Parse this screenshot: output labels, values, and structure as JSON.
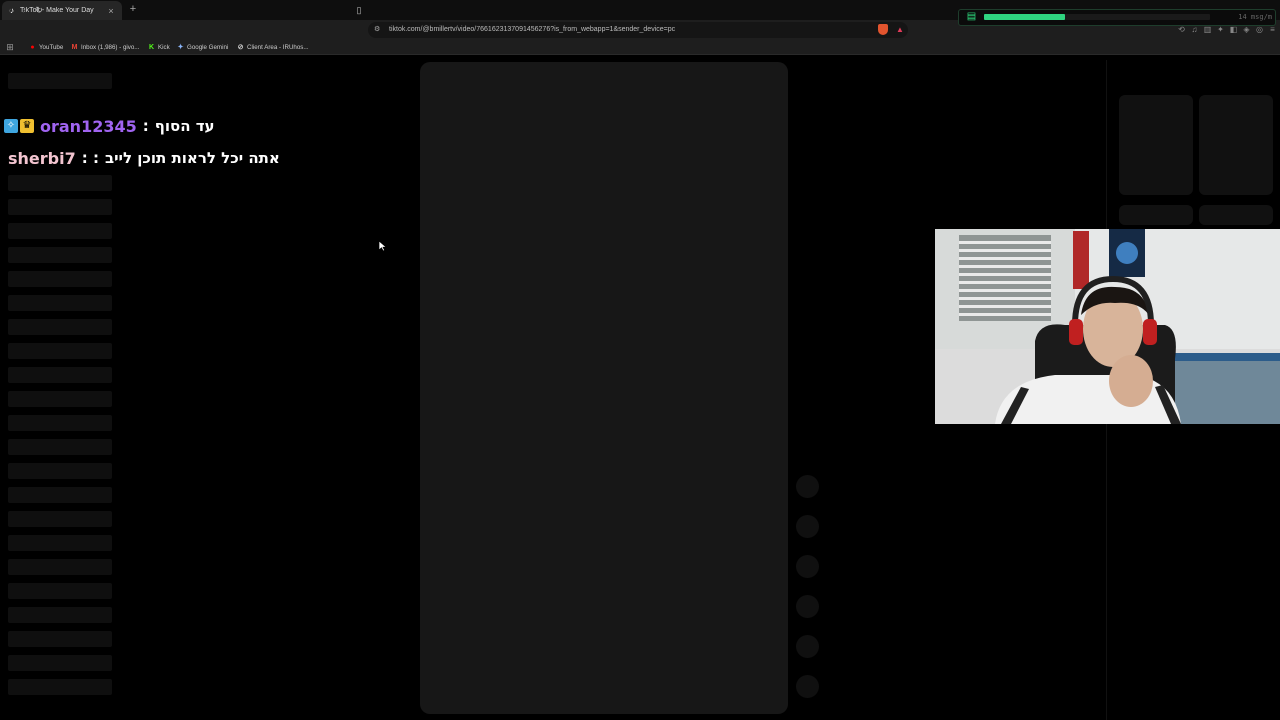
{
  "browser": {
    "tab_title": "TikTok - Make Your Day",
    "url": "tiktok.com/@bmillertv/video/7661623137091456276?is_from_webapp=1&sender_device=pc",
    "bookmarks": [
      {
        "icon": "youtube-icon",
        "label": "YouTube",
        "color": "#ff0000"
      },
      {
        "icon": "gmail-icon",
        "label": "Inbox (1,986) - givo...",
        "color": "#ea4335"
      },
      {
        "icon": "kick-icon",
        "label": "Kick",
        "color": "#53fc18"
      },
      {
        "icon": "gemini-icon",
        "label": "Google Gemini",
        "color": "#8ab4f8"
      },
      {
        "icon": "client-area-icon",
        "label": "Client Area - IRUhos...",
        "color": "#cccccc"
      }
    ]
  },
  "chat": {
    "messages": [
      {
        "user": "oran12345",
        "separator": ":",
        "text": "עד הסוף",
        "user_color": "#a064f0",
        "badges": [
          "pin-badge-icon",
          "crown-badge-icon"
        ]
      },
      {
        "user": "sherbi7",
        "separator": ": :",
        "text": "אתה יכל לראות תוכן לייב",
        "user_color": "#f2c4cf",
        "badges": []
      }
    ]
  },
  "chat_rate_widget": {
    "rate_label": "14 msg/m",
    "fill_fraction": 0.36,
    "accent_color": "#2fd480"
  }
}
